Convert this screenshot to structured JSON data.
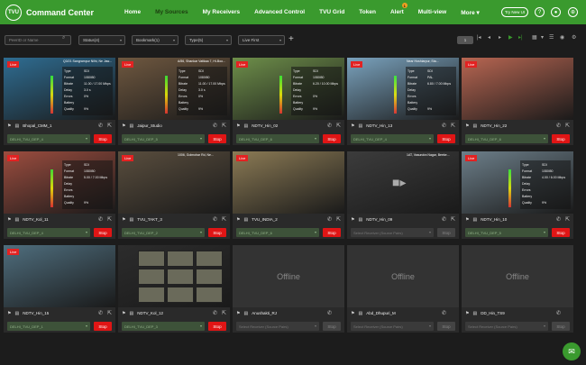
{
  "app": {
    "title": "Command Center",
    "logo": "TVU"
  },
  "nav": [
    {
      "label": "Home",
      "badge": ""
    },
    {
      "label": "My Sources",
      "badge": ""
    },
    {
      "label": "My Receivers",
      "badge": ""
    },
    {
      "label": "Advanced Control",
      "badge": ""
    },
    {
      "label": "TVU Grid",
      "badge": ""
    },
    {
      "label": "Token",
      "badge": ""
    },
    {
      "label": "Alert",
      "badge": "1"
    },
    {
      "label": "Multi-view",
      "badge": ""
    },
    {
      "label": "More ▾",
      "badge": ""
    }
  ],
  "header": {
    "try_label": "Try New UI"
  },
  "toolbar": {
    "search_placeholder": "PeerID or Name",
    "status": "Status(4)",
    "bookmark": "Bookmark(1)",
    "type": "Type(5)",
    "sort": "Live First",
    "page": "1"
  },
  "stat_labels": [
    "Type",
    "Format",
    "Bitrate",
    "Delay",
    "Errors",
    "Battery",
    "Quality"
  ],
  "cards": [
    {
      "name": "Bhopal_CMM_1",
      "state": "live",
      "live": "Live",
      "location": "Q3/21 Sangrampur Nilhi, Ne Jaw...",
      "stats": [
        "SDI",
        "1080i50",
        "11.00 / 17.00 Mbps",
        "3.0 s",
        "0%",
        "",
        "9%"
      ],
      "receiver": "DELHI_TVU_DEP_4",
      "stop": "Stop",
      "bg": "#2f6d92"
    },
    {
      "name": "Jaipur_Studio",
      "state": "live",
      "live": "Live",
      "location": "A/56, Shankar Vatikaa 7, Hi-Boo...",
      "stats": [
        "SDI",
        "1080i50",
        "11.00 / 17.00 Mbps",
        "3.0 s",
        "0%",
        "",
        "9%"
      ],
      "receiver": "DELHI_TVU_DEP_5",
      "stop": "Stop",
      "bg": "#6f5840"
    },
    {
      "name": "NDTV_Hin_02",
      "state": "live",
      "live": "Live",
      "location": "",
      "stats": [
        "SDI",
        "1080i50",
        "6.20 / 10.00 Mbps",
        "",
        "0%",
        "",
        "9%"
      ],
      "receiver": "DELHI_TVU_DEP_6",
      "stop": "Stop",
      "bg": "#6e8f4a"
    },
    {
      "name": "NDTV_Hin_13",
      "state": "live",
      "live": "Live",
      "location": "Near Hoshiarpur, Sta...",
      "stats": [
        "SDI",
        "PAL",
        "6.80 / 7.00 Mbps",
        "",
        "",
        "",
        "9%"
      ],
      "receiver": "DELHI_TVU_DEP_4",
      "stop": "Stop",
      "bg": "#7aa2bd"
    },
    {
      "name": "NDTV_Hin_22",
      "state": "live",
      "live": "Live",
      "location": "",
      "stats": [
        "",
        "",
        "",
        "",
        "",
        "",
        ""
      ],
      "receiver": "DELHI_TVU_DEP_6",
      "stop": "Stop",
      "bg": "#b86652"
    },
    {
      "name": "NDTV_Kol_11",
      "state": "live",
      "live": "Live",
      "location": "",
      "stats": [
        "SDI",
        "1080i50",
        "5.00 / 7.00 Mbps",
        "",
        "",
        "",
        "9%"
      ],
      "receiver": "DELHI_TVU_DEP_4",
      "stop": "Stop",
      "bg": "#9c4d3f"
    },
    {
      "name": "TVU_TAKT_3",
      "state": "live",
      "live": "Live",
      "location": "1006, Golmohar Rd, Ne...",
      "stats": [
        "",
        "",
        "",
        "",
        "",
        "",
        ""
      ],
      "receiver": "DELHI_TVU_DEP_2",
      "stop": "Stop",
      "bg": "#5a4e3e"
    },
    {
      "name": "TVU_INDIA_2",
      "state": "live",
      "live": "Live",
      "location": "",
      "stats": [
        "",
        "",
        "",
        "",
        "",
        "",
        ""
      ],
      "receiver": "DELHI_TVU_DEP_6",
      "stop": "Stop",
      "bg": "#8c7b55"
    },
    {
      "name": "NDTV_Hin_09",
      "state": "idle",
      "live": "",
      "location": "1AT, Vasundra Nagar, Beeke...",
      "stats": [
        "",
        "",
        "",
        "",
        "",
        "",
        ""
      ],
      "receiver": "Select Receiver (Source Pairs)",
      "stop": "Stop",
      "bg": "#3c3c3c"
    },
    {
      "name": "NDTV_Hin_10",
      "state": "live",
      "live": "Live",
      "location": "",
      "stats": [
        "SDI",
        "1080i50",
        "4.00 / 6.00 Mbps",
        "",
        "",
        "",
        "9%"
      ],
      "receiver": "DELHI_TVU_DEP_5",
      "stop": "Stop",
      "bg": "#6d7f8a"
    },
    {
      "name": "NDTV_Hin_15",
      "state": "live",
      "live": "Live",
      "location": "",
      "stats": [
        "",
        "",
        "",
        "",
        "",
        "",
        ""
      ],
      "receiver": "DELHI_TVU_DEP_1",
      "stop": "Stop",
      "bg": "#4f6e7e"
    },
    {
      "name": "NDTV_Kol_12",
      "state": "mosaic",
      "live": "",
      "location": "",
      "stats": [
        "",
        "",
        "",
        "",
        "",
        "",
        ""
      ],
      "receiver": "DELHI_TVU_DEP_3",
      "stop": "Stop",
      "bg": "#2c2c2c"
    },
    {
      "name": "Anushakti_RJ",
      "state": "offline",
      "live": "",
      "location": "",
      "stats": [],
      "receiver": "Select Receiver (Source Pairs)",
      "stop": "Stop",
      "bg": "#333"
    },
    {
      "name": "Abd_Dhupuri_M",
      "state": "offline",
      "live": "",
      "location": "",
      "stats": [],
      "receiver": "Select Receiver (Source Pairs)",
      "stop": "Stop",
      "bg": "#333"
    },
    {
      "name": "DD_Hin_TS9",
      "state": "offline",
      "live": "",
      "location": "",
      "stats": [],
      "receiver": "Select Receiver (Source Pairs)",
      "stop": "Stop",
      "bg": "#333"
    }
  ],
  "offline_label": "Offline"
}
